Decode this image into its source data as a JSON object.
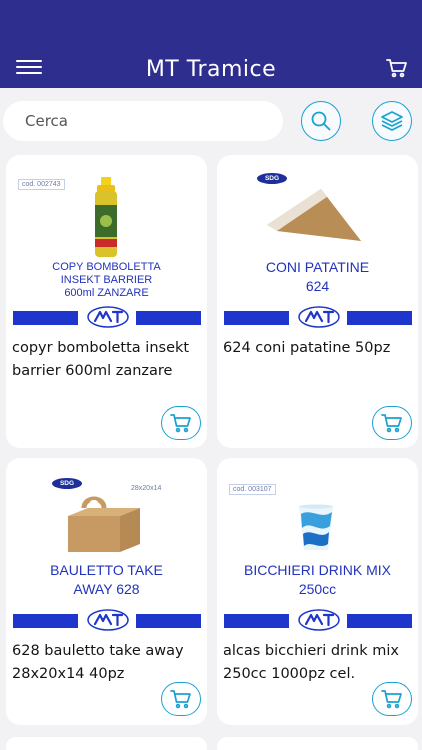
{
  "header": {
    "title": "MT Tramice"
  },
  "search": {
    "placeholder": "Cerca"
  },
  "icons": {
    "menu": "hamburger-menu-icon",
    "cart": "shopping-cart-icon",
    "search": "search-icon",
    "layers": "layers-icon"
  },
  "colors": {
    "header_bg": "#2e2e8f",
    "accent": "#1ba1d1",
    "product_blue": "#1e36cc"
  },
  "products": [
    {
      "name": "copyr bomboletta insekt barrier 600ml zanzare",
      "code": "cod. 002743",
      "caption": [
        "COPY BOMBOLETTA",
        "INSEKT BARRIER",
        "600ml ZANZARE"
      ]
    },
    {
      "name": "624 coni patatine 50pz",
      "brand": "SDG",
      "caption": [
        "CONI PATATINE",
        "624"
      ]
    },
    {
      "name": "628 bauletto take away 28x20x14 40pz",
      "brand": "SDG",
      "size_tag": "28x20x14",
      "caption": [
        "BAULETTO TAKE",
        "AWAY 628"
      ]
    },
    {
      "name": "alcas bicchieri drink mix 250cc 1000pz cel.",
      "code": "cod. 003107",
      "caption": [
        "BICCHIERI DRINK MIX",
        "250cc"
      ]
    }
  ]
}
